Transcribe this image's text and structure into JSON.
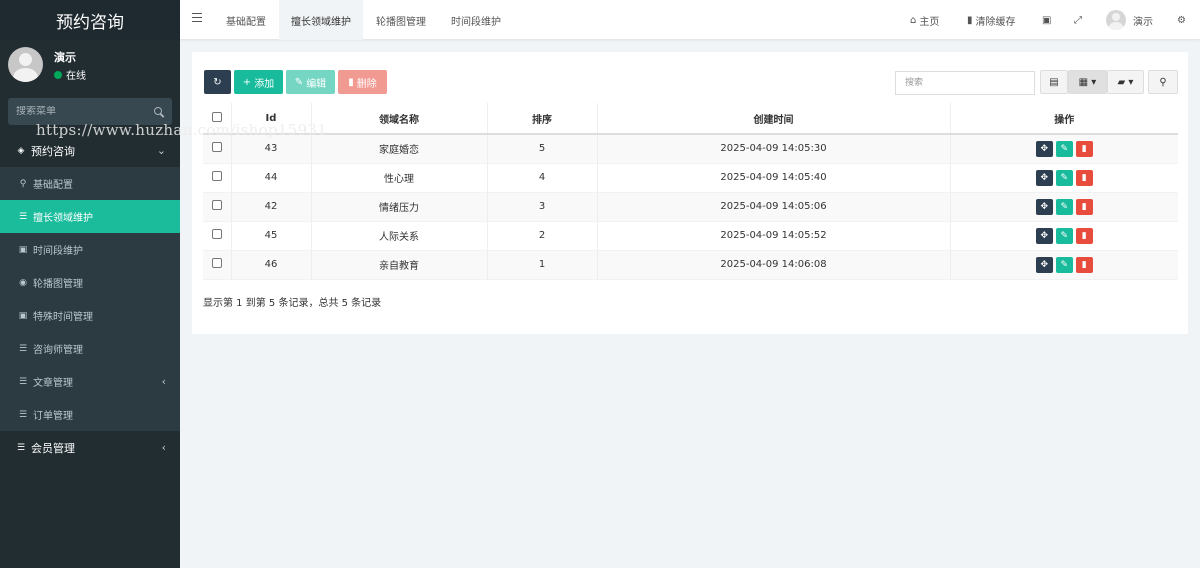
{
  "sidebar": {
    "brand": "预约咨询",
    "user_name": "演示",
    "user_status": "在线",
    "search_placeholder": "搜索菜单",
    "section": "预约咨询",
    "items": [
      {
        "label": "基础配置",
        "icon": "map-marker-icon"
      },
      {
        "label": "擅长领域维护",
        "icon": "list-icon",
        "active": true
      },
      {
        "label": "时间段维护",
        "icon": "image-icon"
      },
      {
        "label": "轮播图管理",
        "icon": "disc-icon"
      },
      {
        "label": "特殊时间管理",
        "icon": "picture-icon"
      },
      {
        "label": "咨询师管理",
        "icon": "list-icon"
      },
      {
        "label": "文章管理",
        "icon": "list-icon"
      },
      {
        "label": "订单管理",
        "icon": "list-icon"
      }
    ],
    "member": "会员管理"
  },
  "topbar": {
    "tabs": [
      "基础配置",
      "擅长领域维护",
      "轮播图管理",
      "时间段维护"
    ],
    "home": "主页",
    "clear_cache": "清除缓存",
    "user": "演示"
  },
  "toolbar": {
    "add": "添加",
    "edit": "编辑",
    "delete": "删除",
    "search_placeholder": "搜索"
  },
  "table": {
    "headers": [
      "Id",
      "领域名称",
      "排序",
      "创建时间",
      "操作"
    ],
    "rows": [
      {
        "id": "43",
        "name": "家庭婚恋",
        "sort": "5",
        "created": "2025-04-09 14:05:30"
      },
      {
        "id": "44",
        "name": "性心理",
        "sort": "4",
        "created": "2025-04-09 14:05:40"
      },
      {
        "id": "42",
        "name": "情绪压力",
        "sort": "3",
        "created": "2025-04-09 14:05:06"
      },
      {
        "id": "45",
        "name": "人际关系",
        "sort": "2",
        "created": "2025-04-09 14:05:52"
      },
      {
        "id": "46",
        "name": "亲自教育",
        "sort": "1",
        "created": "2025-04-09 14:06:08"
      }
    ],
    "summary": "显示第 1 到第 5 条记录，总共 5 条记录"
  },
  "watermark": "https://www.huzhan.com/ishop15931",
  "colors": {
    "sidebar": "#222d32",
    "active": "#1abc9c",
    "primary_dark": "#2c3e50",
    "danger": "#e74c3c"
  }
}
